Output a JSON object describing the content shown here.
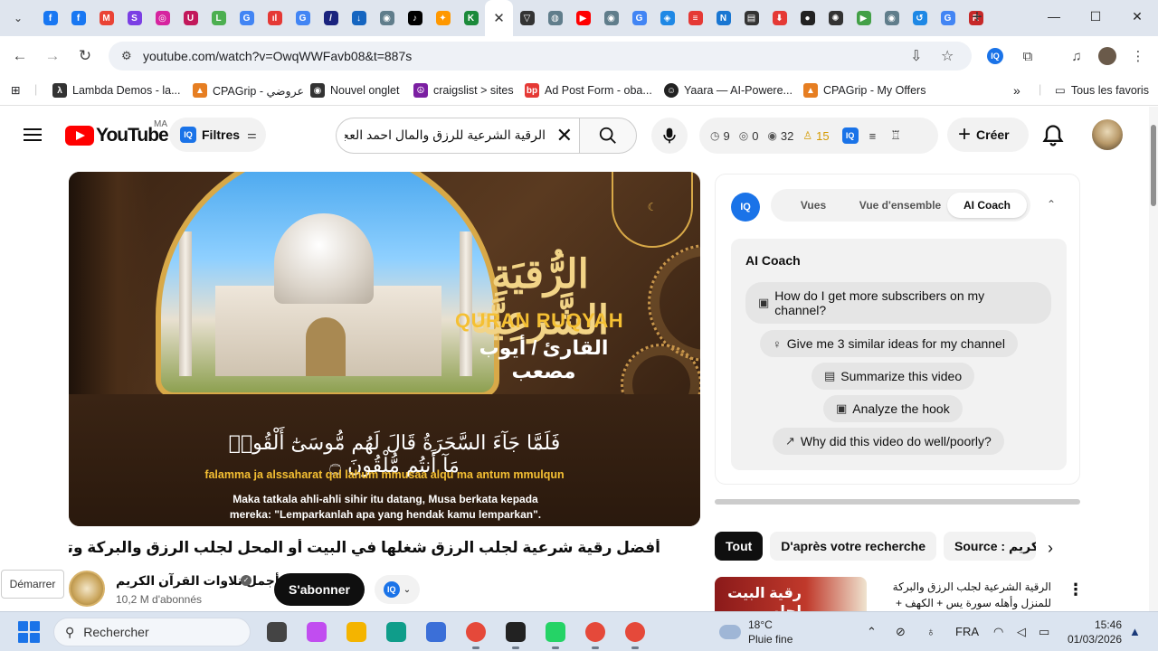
{
  "browser": {
    "active_tab_close": "✕",
    "new_tab": "+",
    "window_controls": {
      "minimize": "—",
      "maximize": "☐",
      "close": "✕"
    },
    "url": "youtube.com/watch?v=OwqWWFavb08&t=887s",
    "tab_icons": [
      {
        "name": "facebook-tab-icon",
        "glyph": "f",
        "color": "#1877f2"
      },
      {
        "name": "facebook-tab-icon-2",
        "glyph": "f",
        "color": "#1877f2"
      },
      {
        "name": "gmail-tab-icon",
        "glyph": "M",
        "color": "#ea4335"
      },
      {
        "name": "s-tab-icon",
        "glyph": "S",
        "color": "#7b3fe4"
      },
      {
        "name": "instagram-tab-icon",
        "glyph": "◎",
        "color": "#d6249f"
      },
      {
        "name": "u-tab-icon",
        "glyph": "U",
        "color": "#c2185b"
      },
      {
        "name": "l-tab-icon",
        "glyph": "L",
        "color": "#4caf50"
      },
      {
        "name": "google-tab-icon",
        "glyph": "G",
        "color": "#4285f4"
      },
      {
        "name": "audio-tab-icon",
        "glyph": "ıl",
        "color": "#e53935"
      },
      {
        "name": "google-tab-icon-2",
        "glyph": "G",
        "color": "#4285f4"
      },
      {
        "name": "slash-tab-icon",
        "glyph": "/",
        "color": "#1a237e"
      },
      {
        "name": "download-tab-icon",
        "glyph": "↓",
        "color": "#1565c0"
      },
      {
        "name": "chrome-tab-icon",
        "glyph": "◉",
        "color": "#607d8b"
      },
      {
        "name": "tiktok-tab-icon",
        "glyph": "♪",
        "color": "#000000"
      },
      {
        "name": "puzzle-tab-icon",
        "glyph": "✦",
        "color": "#ff9800"
      },
      {
        "name": "k-tab-icon",
        "glyph": "K",
        "color": "#1b8a3a"
      }
    ],
    "tab_icons_right": [
      {
        "name": "v-tab-icon",
        "glyph": "▽",
        "color": "#333333"
      },
      {
        "name": "globe-tab-icon",
        "glyph": "◍",
        "color": "#607d8b"
      },
      {
        "name": "youtube-tab-icon",
        "glyph": "▶",
        "color": "#ff0000"
      },
      {
        "name": "chrome-tab-icon-2",
        "glyph": "◉",
        "color": "#607d8b"
      },
      {
        "name": "google-tab-icon-3",
        "glyph": "G",
        "color": "#4285f4"
      },
      {
        "name": "compass-tab-icon",
        "glyph": "◈",
        "color": "#1e88e5"
      },
      {
        "name": "bars-tab-icon",
        "glyph": "≡",
        "color": "#e53935"
      },
      {
        "name": "n-tab-icon",
        "glyph": "N",
        "color": "#1976d2"
      },
      {
        "name": "print-tab-icon",
        "glyph": "▤",
        "color": "#333333"
      },
      {
        "name": "save-tab-icon",
        "glyph": "⬇",
        "color": "#e53935"
      },
      {
        "name": "circle-tab-icon",
        "glyph": "●",
        "color": "#222222"
      },
      {
        "name": "openai-tab-icon",
        "glyph": "✺",
        "color": "#333333"
      },
      {
        "name": "play-tab-icon",
        "glyph": "▶",
        "color": "#43a047"
      },
      {
        "name": "chrome-tab-icon-3",
        "glyph": "◉",
        "color": "#607d8b"
      },
      {
        "name": "history-tab-icon",
        "glyph": "↺",
        "color": "#1e88e5"
      },
      {
        "name": "google-tab-icon-4",
        "glyph": "G",
        "color": "#4285f4"
      },
      {
        "name": "red-tab-icon",
        "glyph": "R",
        "color": "#c62828"
      }
    ]
  },
  "bookmarks": {
    "items": [
      {
        "label": "Lambda Demos - la...",
        "glyph": "λ",
        "color": "#333333"
      },
      {
        "label": "CPAGrip - عروضي",
        "glyph": "▲",
        "color": "#e67e22"
      },
      {
        "label": "Nouvel onglet",
        "glyph": "◉",
        "color": "#333333"
      },
      {
        "label": "craigslist > sites",
        "glyph": "☮",
        "color": "#7b1fa2"
      },
      {
        "label": "Ad Post Form - oba...",
        "glyph": "bp",
        "color": "#e53935"
      },
      {
        "label": "Yaara — AI-Powere...",
        "glyph": "☺",
        "color": "#222222"
      },
      {
        "label": "CPAGrip - My Offers",
        "glyph": "▲",
        "color": "#e67e22"
      }
    ],
    "overflow": "»",
    "all_bookmarks": "Tous les favoris"
  },
  "youtube": {
    "logo_text": "YouTube",
    "country": "MA",
    "filtres_label": "Filtres",
    "search_query": "الرقية الشرعية للرزق والمال احمد العجمي",
    "stats": {
      "clock": "9",
      "views_small": "0",
      "eye": "32",
      "users": "15"
    },
    "creer_label": "Créer"
  },
  "video": {
    "thumb_title_ar": "الرُّقيَةِ الشَّرعِيَّة",
    "thumb_title_en": "QURAN RUQYAH",
    "reader": "القارئ / أيوب مصعب",
    "verse_ar": "فَلَمَّا جَآءَ السَّحَرَةُ قَالَ لَهُم مُّوسَىٰٓ أَلْقُوا۟ مَآ أَنتُم مُّلْقُونَ ۝",
    "verse_translit": "falamma ja alssaharat qal lahum mmusaa alqu ma antum mmulqun",
    "verse_id_1": "Maka tatkala ahli-ahli sihir itu datang, Musa berkata kepada",
    "verse_id_2": "mereka: \"Lemparkanlah apa yang hendak kamu lemparkan\".",
    "title": "أفضل رقية شرعية لجلب الرزق شغلها في البيت أو المحل لجلب الرزق والبركة وتيسير الأمور بإذن الله",
    "channel_name": "أجمل تلاوات القرآن الكريم",
    "subscribers": "10,2 M d'abonnés",
    "subscribe_label": "S'abonner",
    "demarrer_label": "Démarrer"
  },
  "panel": {
    "tabs": [
      "Vues",
      "Vue d'ensemble",
      "AI Coach"
    ],
    "active_tab": "AI Coach",
    "coach_title": "AI Coach",
    "suggestions": [
      "How do I get more subscribers on my channel?",
      "Give me 3 similar ideas for my channel",
      "Summarize this video",
      "Analyze the hook",
      "Why did this video do well/poorly?"
    ]
  },
  "chips": [
    "Tout",
    "D'après votre recherche",
    "Source : القرآن الكريم"
  ],
  "related": {
    "thumb_text": "رقية البيت لجلب",
    "title": "الرقية الشرعية لجلب الرزق والبركة للمنزل وأهله سورة يس + الكهف + مريم + طه | ..."
  },
  "taskbar": {
    "search_placeholder": "Rechercher",
    "weather_temp": "18°C",
    "weather_desc": "Pluie fine",
    "language": "FRA",
    "time": "15:46",
    "date": "01/03/2026",
    "apps": [
      {
        "name": "task-view-taskbar-icon",
        "color": "#444444"
      },
      {
        "name": "copilot-taskbar-icon",
        "color": "#c14df0"
      },
      {
        "name": "file-explorer-taskbar-icon",
        "color": "#f4b400"
      },
      {
        "name": "edge-taskbar-icon",
        "color": "#0f9d8a"
      },
      {
        "name": "store-taskbar-icon",
        "color": "#3b6fd8"
      },
      {
        "name": "chrome-taskbar-icon",
        "color": "#e5493a"
      },
      {
        "name": "app-taskbar-icon",
        "color": "#222222"
      },
      {
        "name": "whatsapp-taskbar-icon",
        "color": "#25d366"
      },
      {
        "name": "chrome-profile-taskbar-icon",
        "color": "#e5493a"
      },
      {
        "name": "chrome-profile-taskbar-icon-2",
        "color": "#e5493a"
      }
    ]
  }
}
